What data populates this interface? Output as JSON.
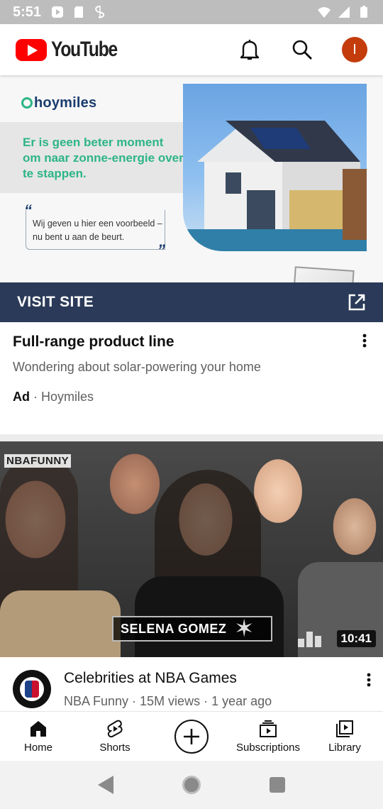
{
  "status_bar": {
    "time": "5:51"
  },
  "header": {
    "logo_text": "YouTube",
    "avatar_initial": "I"
  },
  "ad": {
    "brand": "hoymiles",
    "headline": "Er is geen beter moment om naar zonne-energie over te stappen.",
    "quote": "Wij geven u hier een voorbeeld – nu bent u aan de beurt.",
    "cta": "VISIT SITE",
    "title": "Full-range product line",
    "description": "Wondering about solar-powering your home",
    "badge": "Ad",
    "advertiser": "Hoymiles",
    "separator": " · "
  },
  "video": {
    "channel_watermark": "NBAFUNNY",
    "overlay_text": "SELENA GOMEZ",
    "duration": "10:41",
    "title": "Celebrities at NBA Games",
    "meta": "NBA Funny · 15M views · 1 year ago"
  },
  "bottom_nav": {
    "items": [
      {
        "label": "Home"
      },
      {
        "label": "Shorts"
      },
      {
        "label": ""
      },
      {
        "label": "Subscriptions"
      },
      {
        "label": "Library"
      }
    ]
  },
  "colors": {
    "brand_red": "#ff0000",
    "cta_bar": "#2a3a58",
    "ad_green": "#2db585",
    "avatar": "#c43c0c"
  }
}
